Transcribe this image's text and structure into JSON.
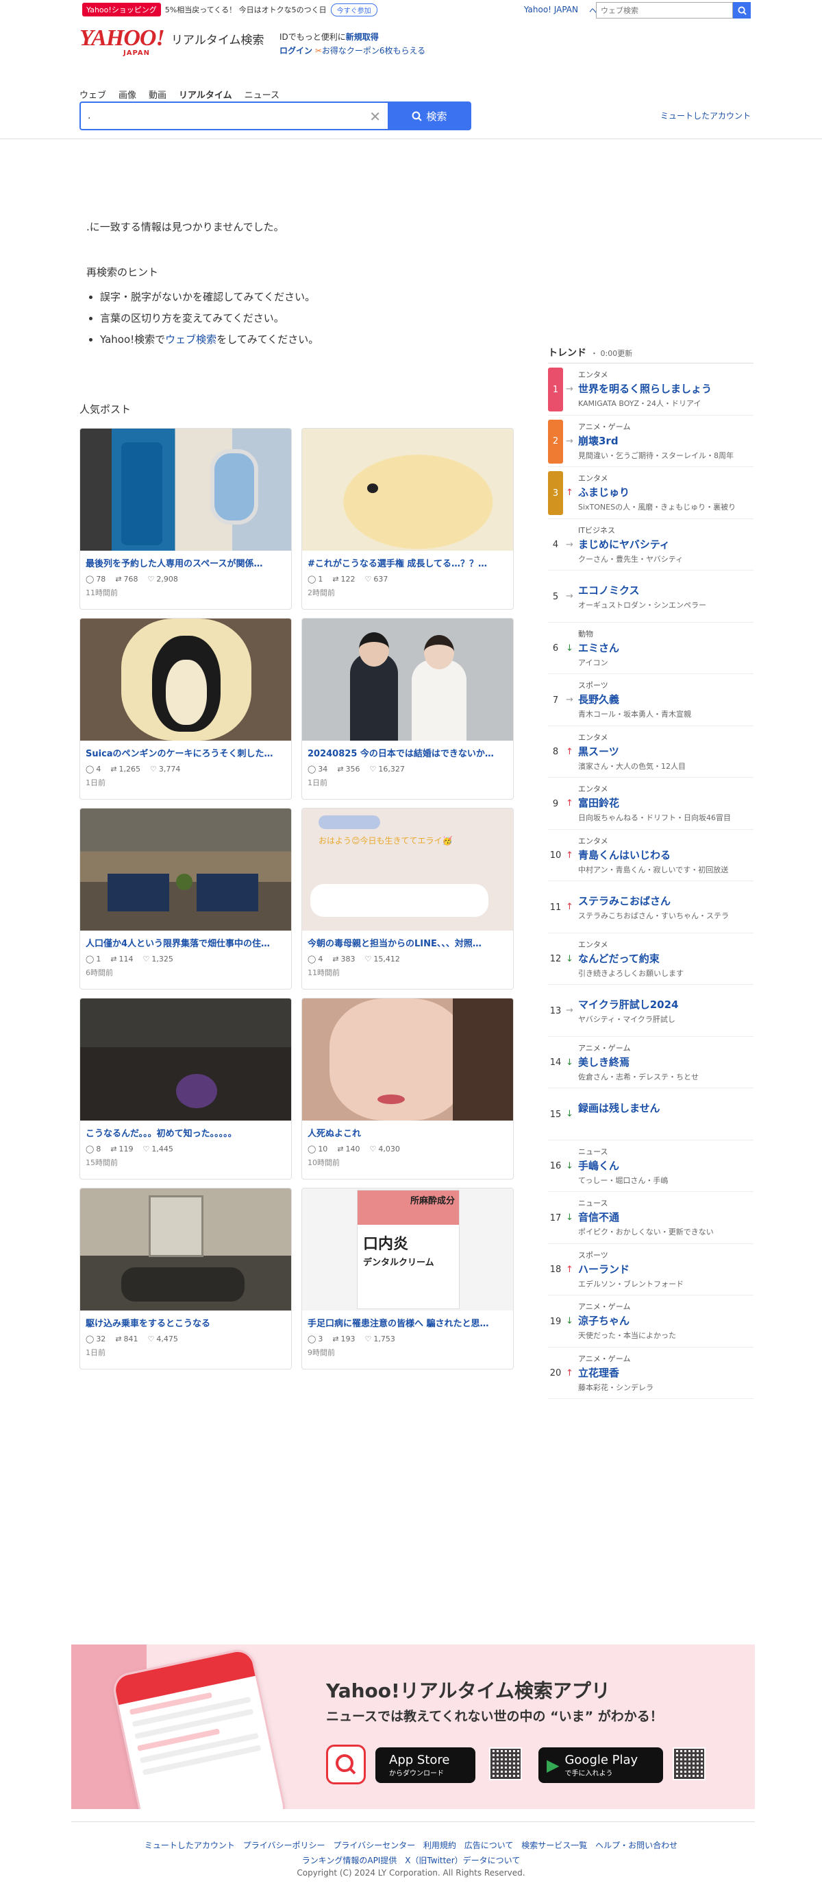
{
  "promo": {
    "tag": "Yahoo!ショッピング",
    "text": "5%相当戻ってくる！ 今日はオトクな5のつく日",
    "button": "今すぐ参加"
  },
  "toplinks": {
    "yahoo_japan": "Yahoo! JAPAN",
    "help": "ヘルプ"
  },
  "topsearch": {
    "placeholder": "ウェブ検索"
  },
  "header": {
    "logo": "YAHOO!",
    "logo_jp": "JAPAN",
    "service": "リアルタイム検索",
    "id_text": "IDでもっと便利に",
    "register": "新規取得",
    "login": "ログイン",
    "coupon": "お得なクーポン6枚もらえる"
  },
  "tabs": [
    "ウェブ",
    "画像",
    "動画",
    "リアルタイム",
    "ニュース"
  ],
  "search": {
    "value": ".",
    "button": "検索"
  },
  "muted_accounts": "ミュートしたアカウント",
  "main": {
    "not_found": ".に一致する情報は見つかりませんでした。",
    "hint_title": "再検索のヒント",
    "hint1": "誤字・脱字がないかを確認してみてください。",
    "hint2": "言葉の区切り方を変えてみてください。",
    "hint3_pre": "Yahoo!検索で",
    "hint3_link": "ウェブ検索",
    "hint3_post": "をしてみてください。"
  },
  "popular": {
    "title": "人気ポスト",
    "posts": [
      {
        "title": "最後列を予約した人専用のスペースが関係…",
        "replies": "78",
        "reposts": "768",
        "likes": "2,908",
        "time": "11時間前"
      },
      {
        "title": "#これがこうなる選手権 成長してる…？？…",
        "replies": "1",
        "reposts": "122",
        "likes": "637",
        "time": "2時間前"
      },
      {
        "title": "Suicaのペンギンのケーキにろうそく刺した…",
        "replies": "4",
        "reposts": "1,265",
        "likes": "3,774",
        "time": "1日前"
      },
      {
        "title": "20240825 今の日本では結婚はできないか…",
        "replies": "34",
        "reposts": "356",
        "likes": "16,327",
        "time": "1日前"
      },
      {
        "title": "人口僅か4人という限界集落で畑仕事中の住…",
        "replies": "1",
        "reposts": "114",
        "likes": "1,325",
        "time": "6時間前"
      },
      {
        "title": "今朝の毒母親と担当からのLINE、、、対照…",
        "replies": "4",
        "reposts": "383",
        "likes": "15,412",
        "time": "11時間前",
        "overlay": "おはよう😊今日も生きててエライ🥳"
      },
      {
        "title": "こうなるんだ。。。初めて知った。。。。。",
        "replies": "8",
        "reposts": "119",
        "likes": "1,445",
        "time": "15時間前"
      },
      {
        "title": "人死ぬよこれ",
        "replies": "10",
        "reposts": "140",
        "likes": "4,030",
        "time": "10時間前"
      },
      {
        "title": "駆け込み乗車をするとこうなる",
        "replies": "32",
        "reposts": "841",
        "likes": "4,475",
        "time": "1日前"
      },
      {
        "title": "手足口病に罹患注意の皆様へ 騙されたと思…",
        "replies": "3",
        "reposts": "193",
        "likes": "1,753",
        "time": "9時間前",
        "product_top": "所麻酔成分",
        "product_main": "口内炎",
        "product_sub": "デンタルクリーム"
      }
    ]
  },
  "trend": {
    "title": "トレンド",
    "updated": "0:00更新",
    "items": [
      {
        "rank": "1",
        "dir": "flat",
        "cat": "エンタメ",
        "word": "世界を明るく照らしましょう",
        "rel": "KAMIGATA BOYZ・24人・ドリアイ"
      },
      {
        "rank": "2",
        "dir": "flat",
        "cat": "アニメ・ゲーム",
        "word": "崩壊3rd",
        "rel": "見間違い・乞うご期待・スターレイル・8周年"
      },
      {
        "rank": "3",
        "dir": "up",
        "cat": "エンタメ",
        "word": "ふまじゅり",
        "rel": "SixTONESの人・風磨・きょもじゅり・裏被り"
      },
      {
        "rank": "4",
        "dir": "flat",
        "cat": "ITビジネス",
        "word": "まじめにヤバシティ",
        "rel": "クーさん・豊先生・ヤバシティ"
      },
      {
        "rank": "5",
        "dir": "flat",
        "cat": "",
        "word": "エコノミクス",
        "rel": "オーギュストロダン・シンエンペラー"
      },
      {
        "rank": "6",
        "dir": "down",
        "cat": "動物",
        "word": "エミさん",
        "rel": "アイコン"
      },
      {
        "rank": "7",
        "dir": "flat",
        "cat": "スポーツ",
        "word": "長野久義",
        "rel": "青木コール・坂本勇人・青木宣親"
      },
      {
        "rank": "8",
        "dir": "up",
        "cat": "エンタメ",
        "word": "黒スーツ",
        "rel": "濱家さん・大人の色気・12人目"
      },
      {
        "rank": "9",
        "dir": "up",
        "cat": "エンタメ",
        "word": "富田鈴花",
        "rel": "日向坂ちゃんねる・ドリフト・日向坂46冒目"
      },
      {
        "rank": "10",
        "dir": "up",
        "cat": "エンタメ",
        "word": "青島くんはいじわる",
        "rel": "中村アン・青島くん・寂しいです・初回放送"
      },
      {
        "rank": "11",
        "dir": "up",
        "cat": "",
        "word": "ステラみこおばさん",
        "rel": "ステラみこちおばさん・すいちゃん・ステラ"
      },
      {
        "rank": "12",
        "dir": "down",
        "cat": "エンタメ",
        "word": "なんどだって約束",
        "rel": "引き続きよろしくお願いします"
      },
      {
        "rank": "13",
        "dir": "flat",
        "cat": "",
        "word": "マイクラ肝試し2024",
        "rel": "ヤバシティ・マイクラ肝試し"
      },
      {
        "rank": "14",
        "dir": "down",
        "cat": "アニメ・ゲーム",
        "word": "美しき終焉",
        "rel": "佐倉さん・志希・デレステ・ちとせ"
      },
      {
        "rank": "15",
        "dir": "down",
        "cat": "",
        "word": "録画は残しません",
        "rel": ""
      },
      {
        "rank": "16",
        "dir": "down",
        "cat": "ニュース",
        "word": "手嶋くん",
        "rel": "てっしー・堀口さん・手嶋"
      },
      {
        "rank": "17",
        "dir": "down",
        "cat": "ニュース",
        "word": "音信不通",
        "rel": "ポイピク・おかしくない・更新できない"
      },
      {
        "rank": "18",
        "dir": "up",
        "cat": "スポーツ",
        "word": "ハーランド",
        "rel": "エデルソン・ブレントフォード"
      },
      {
        "rank": "19",
        "dir": "down",
        "cat": "アニメ・ゲーム",
        "word": "涼子ちゃん",
        "rel": "天使だった・本当によかった"
      },
      {
        "rank": "20",
        "dir": "up",
        "cat": "アニメ・ゲーム",
        "word": "立花理香",
        "rel": "藤本彩花・シンデレラ"
      }
    ]
  },
  "banner": {
    "title": "Yahoo!リアルタイム検索アプリ",
    "subtitle": "ニュースでは教えてくれない世の中の “いま” がわかる！",
    "appstore_big": "App Store",
    "appstore_small": "からダウンロード",
    "gplay_big": "Google Play",
    "gplay_small": "で手に入れよう"
  },
  "footer": {
    "links1": [
      "ミュートしたアカウント",
      "プライバシーポリシー",
      "プライバシーセンター",
      "利用規約",
      "広告について",
      "検索サービス一覧",
      "ヘルプ・お問い合わせ"
    ],
    "links2": [
      "ランキング情報のAPI提供",
      "X（旧Twitter）データについて"
    ],
    "copyright": "Copyright (C) 2024 LY Corporation. All Rights Reserved."
  },
  "colors": {
    "accent": "#3b72f0",
    "link": "#1a4fa8",
    "brand": "#d8262d"
  }
}
